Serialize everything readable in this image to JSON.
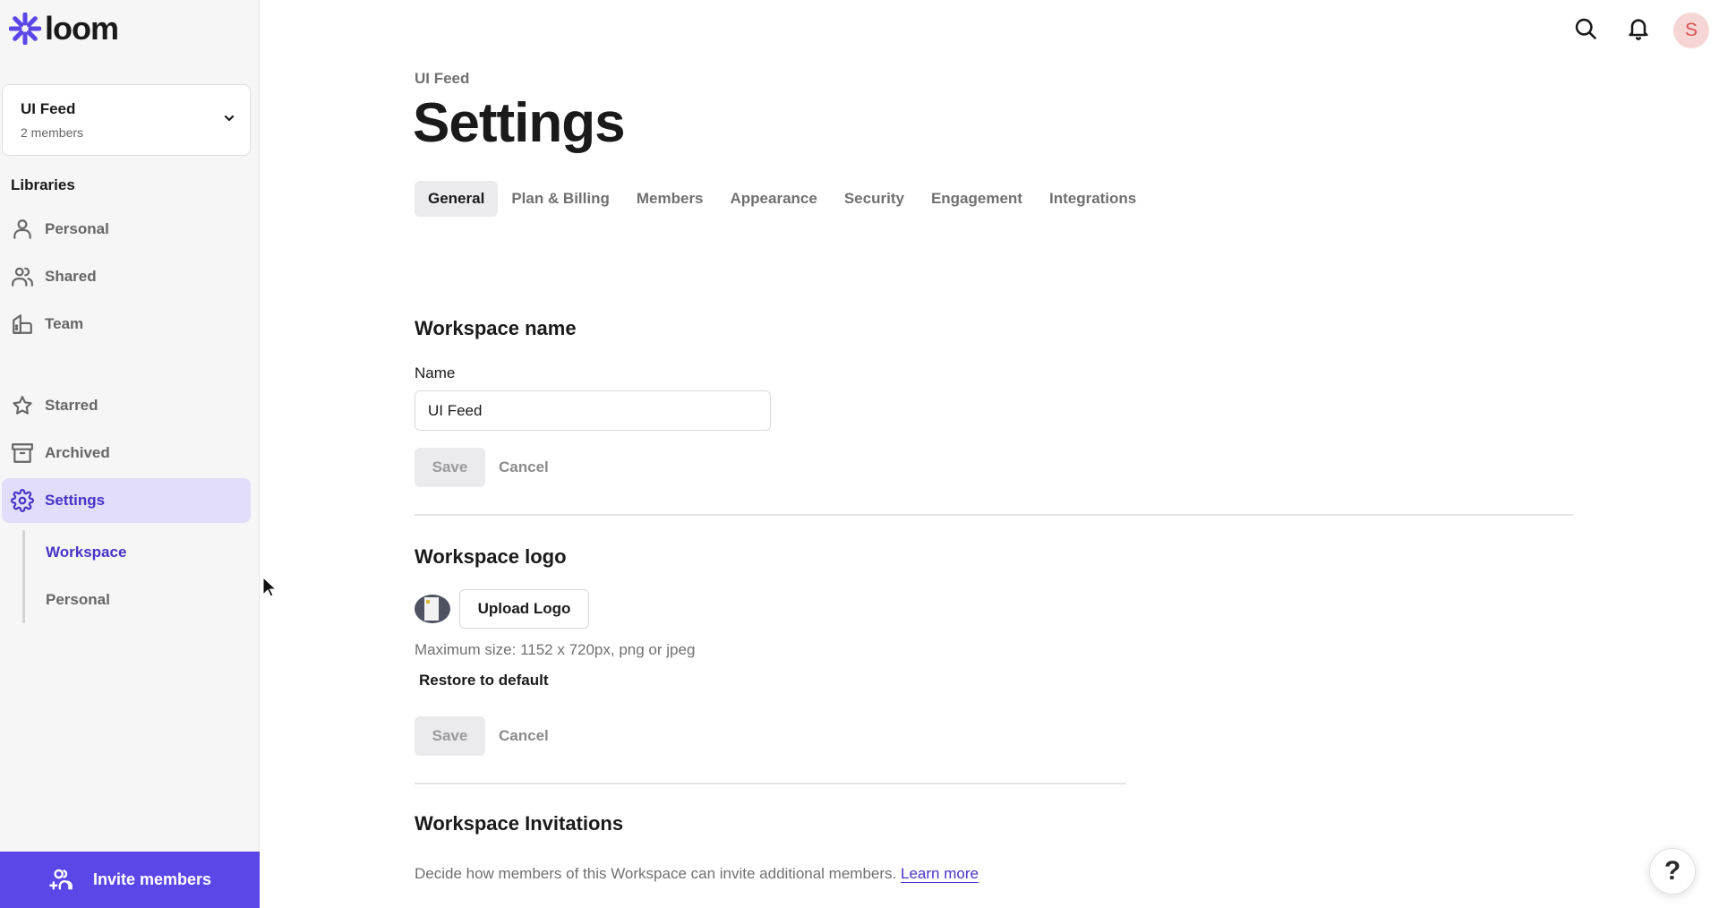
{
  "app": {
    "name": "loom",
    "brand_color": "#5b47e8"
  },
  "sidebar": {
    "workspace": {
      "name": "UI Feed",
      "members": "2 members"
    },
    "libraries_label": "Libraries",
    "libraries": [
      {
        "label": "Personal",
        "icon": "person-icon"
      },
      {
        "label": "Shared",
        "icon": "people-icon"
      },
      {
        "label": "Team",
        "icon": "building-icon"
      }
    ],
    "items": [
      {
        "label": "Starred",
        "icon": "star-icon"
      },
      {
        "label": "Archived",
        "icon": "archive-icon"
      },
      {
        "label": "Settings",
        "icon": "gear-icon",
        "active": true
      }
    ],
    "settings_sub": [
      {
        "label": "Workspace",
        "active": true
      },
      {
        "label": "Personal"
      }
    ],
    "invite_label": "Invite members"
  },
  "header": {
    "avatar_initial": "S"
  },
  "page": {
    "breadcrumb": "UI Feed",
    "title": "Settings",
    "tabs": [
      {
        "label": "General",
        "active": true
      },
      {
        "label": "Plan & Billing"
      },
      {
        "label": "Members"
      },
      {
        "label": "Appearance"
      },
      {
        "label": "Security"
      },
      {
        "label": "Engagement"
      },
      {
        "label": "Integrations"
      }
    ]
  },
  "workspace_name": {
    "heading": "Workspace name",
    "field_label": "Name",
    "value": "UI Feed",
    "save_label": "Save",
    "cancel_label": "Cancel"
  },
  "workspace_logo": {
    "heading": "Workspace logo",
    "upload_label": "Upload Logo",
    "hint": "Maximum size: 1152 x 720px, png or jpeg",
    "restore_label": "Restore to default",
    "save_label": "Save",
    "cancel_label": "Cancel"
  },
  "workspace_invitations": {
    "heading": "Workspace Invitations",
    "description": "Decide how members of this Workspace can invite additional members.",
    "learn_more": "Learn more"
  },
  "help": {
    "label": "?"
  }
}
